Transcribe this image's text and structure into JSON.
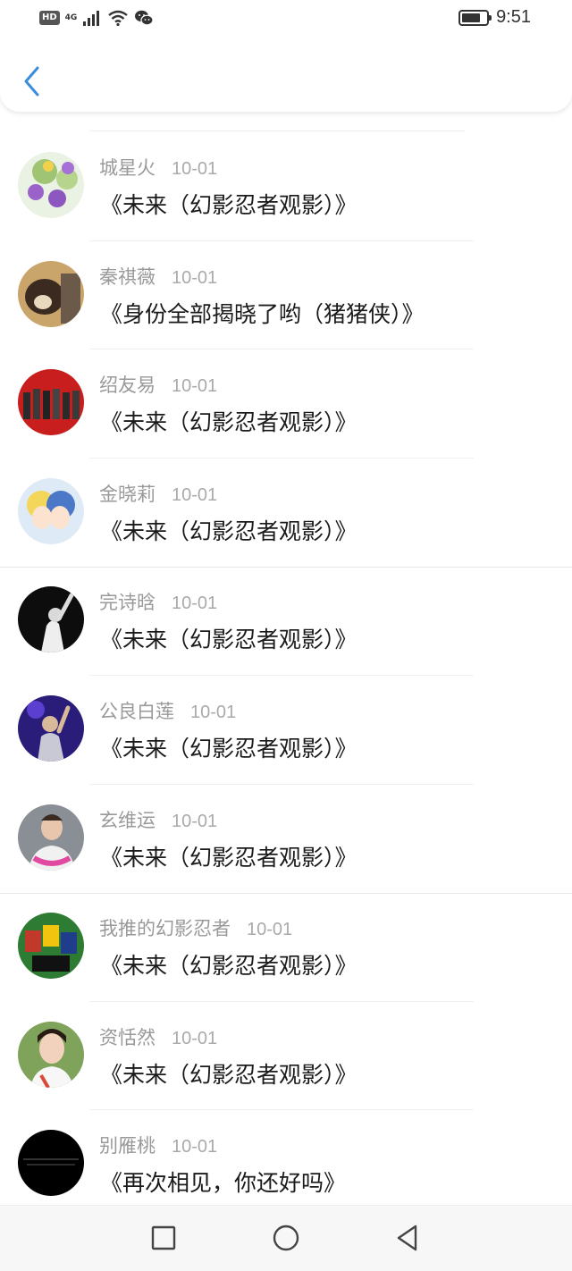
{
  "status_bar": {
    "hd": "HD",
    "network": "4G",
    "time": "9:51",
    "battery_level": 0.75
  },
  "header": {
    "back_icon": "chevron-left-icon",
    "accent_color": "#3b8ddb"
  },
  "items": [
    {
      "name": "城星火",
      "date": "10-01",
      "title": "《未来（幻影忍者观影）》"
    },
    {
      "name": "秦祺薇",
      "date": "10-01",
      "title": "《身份全部揭晓了哟（猪猪侠）》"
    },
    {
      "name": "绍友易",
      "date": "10-01",
      "title": "《未来（幻影忍者观影）》"
    },
    {
      "name": "金晓莉",
      "date": "10-01",
      "title": "《未来（幻影忍者观影）》"
    },
    {
      "name": "完诗晗",
      "date": "10-01",
      "title": "《未来（幻影忍者观影）》"
    },
    {
      "name": "公良白莲",
      "date": "10-01",
      "title": "《未来（幻影忍者观影）》"
    },
    {
      "name": "玄维运",
      "date": "10-01",
      "title": "《未来（幻影忍者观影）》"
    },
    {
      "name": "我推的幻影忍者",
      "date": "10-01",
      "title": "《未来（幻影忍者观影）》"
    },
    {
      "name": "资恬然",
      "date": "10-01",
      "title": "《未来（幻影忍者观影）》"
    },
    {
      "name": "别雁桃",
      "date": "10-01",
      "title": "《再次相见，你还好吗》"
    }
  ],
  "nav": {
    "recents_icon": "square-icon",
    "home_icon": "circle-icon",
    "back_icon": "triangle-back-icon"
  }
}
